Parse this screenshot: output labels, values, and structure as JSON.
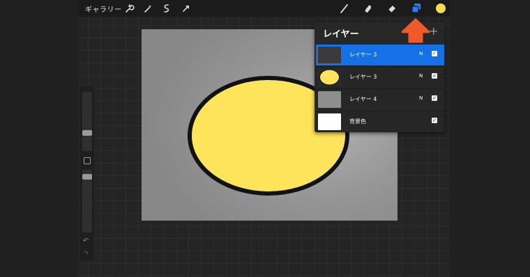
{
  "toolbar": {
    "gallery_label": "ギャラリー",
    "left_tools": [
      {
        "icon": "wrench-icon"
      },
      {
        "icon": "magic-wand-icon"
      },
      {
        "icon": "selection-icon"
      },
      {
        "icon": "transform-arrow-icon"
      }
    ],
    "right_tools": [
      {
        "icon": "brush-icon"
      },
      {
        "icon": "smudge-icon"
      },
      {
        "icon": "eraser-icon"
      },
      {
        "icon": "layers-icon"
      },
      {
        "icon": "color-swatch-icon"
      }
    ],
    "current_color": "#f5dc4e",
    "active_tool_color": "#2a7cf0"
  },
  "annotation": {
    "arrow_color": "#f05a2a"
  },
  "canvas": {
    "background": "#8e8e8e",
    "shape": "ellipse",
    "fill": "#fde45a",
    "stroke": "#101218"
  },
  "sidebar": {
    "undo_icon": "↶",
    "redo_icon": "↷"
  },
  "layers_panel": {
    "title": "レイヤー",
    "add_icon": "+",
    "layers": [
      {
        "name": "レイヤー 3",
        "blend": "N",
        "thumb": "dark",
        "active": true,
        "visible": true
      },
      {
        "name": "レイヤー 3",
        "blend": "N",
        "thumb": "yellow-circle",
        "active": false,
        "visible": true
      },
      {
        "name": "レイヤー 4",
        "blend": "N",
        "thumb": "gray",
        "active": false,
        "visible": true
      },
      {
        "name": "背景色",
        "blend": "",
        "thumb": "white",
        "active": false,
        "visible": true
      }
    ]
  }
}
